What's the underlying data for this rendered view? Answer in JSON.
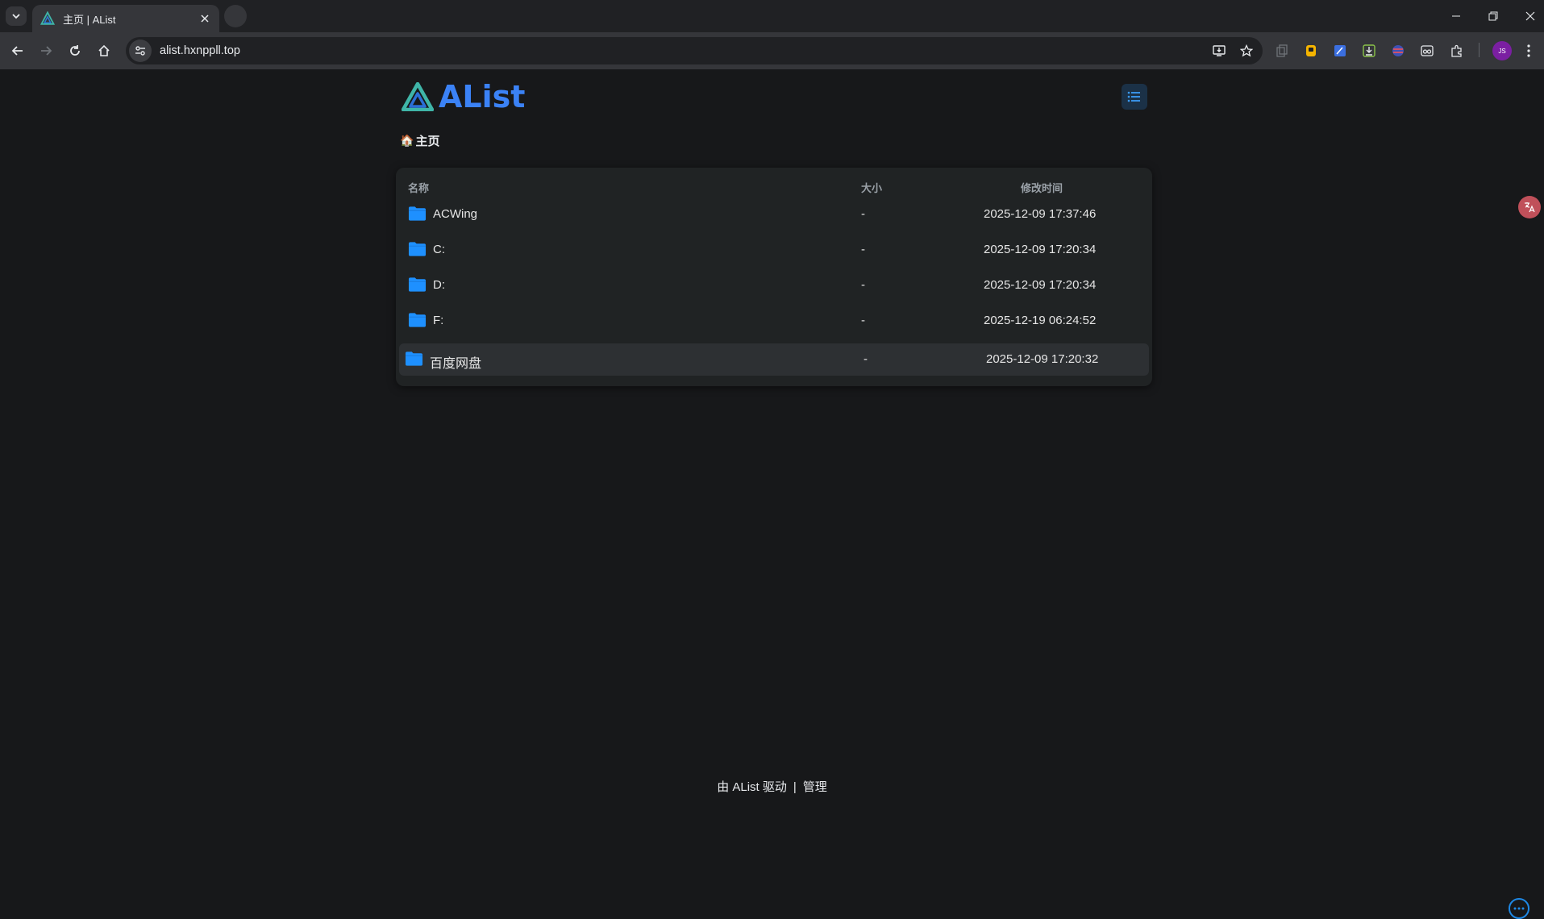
{
  "browser": {
    "tab_title": "主页 | AList",
    "url": "alist.hxnppll.top",
    "avatar_initials": "JS"
  },
  "header": {
    "logo_text": "AList",
    "layout_button_icon": "list-layout-icon"
  },
  "breadcrumb": {
    "home_emoji": "🏠",
    "label": "主页"
  },
  "table": {
    "columns": {
      "name": "名称",
      "size": "大小",
      "modified": "修改时间"
    },
    "rows": [
      {
        "name": "ACWing",
        "size": "-",
        "modified": "2025-12-09 17:37:46"
      },
      {
        "name": "C:",
        "size": "-",
        "modified": "2025-12-09 17:20:34"
      },
      {
        "name": "D:",
        "size": "-",
        "modified": "2025-12-09 17:20:34"
      },
      {
        "name": "F:",
        "size": "-",
        "modified": "2025-12-19 06:24:52"
      },
      {
        "name": "百度网盘",
        "size": "-",
        "modified": "2025-12-09 17:20:32"
      }
    ]
  },
  "footer": {
    "powered": "由 AList 驱动",
    "separator": "|",
    "manage": "管理"
  },
  "colors": {
    "accent": "#3b82f6",
    "folder": "#1e90ff",
    "background": "#17181a",
    "panel": "#202324"
  }
}
